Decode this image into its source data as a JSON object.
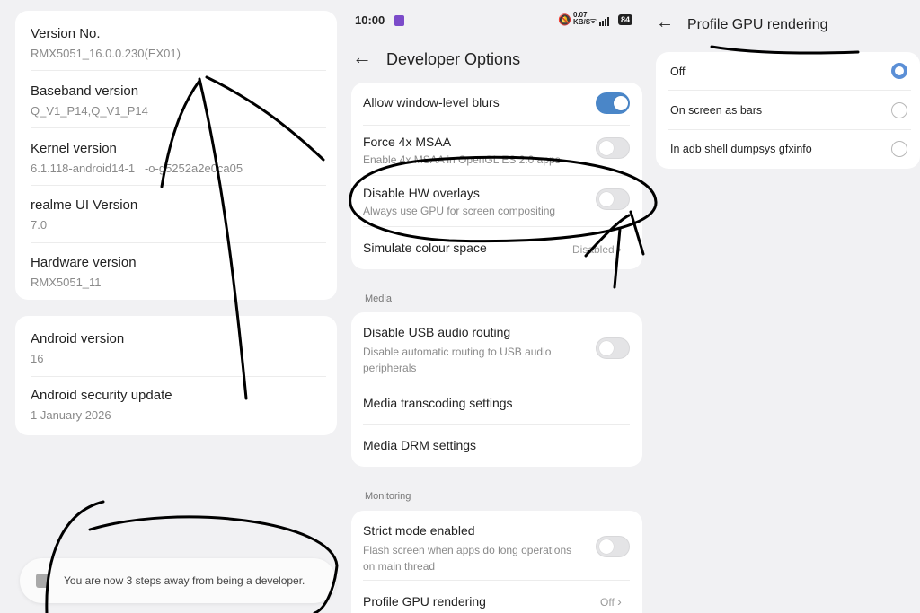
{
  "left": {
    "about_items": [
      {
        "label": "Version No.",
        "value": "RMX5051_16.0.0.230(EX01)"
      },
      {
        "label": "Baseband version",
        "value": "Q_V1_P14,Q_V1_P14"
      },
      {
        "label": "Kernel version",
        "value": "6.1.118-android14-1   -o-g5252a2e0ca05"
      },
      {
        "label": "realme UI Version",
        "value": "7.0"
      },
      {
        "label": "Hardware version",
        "value": "RMX5051_11"
      }
    ],
    "android_items": [
      {
        "label": "Android version",
        "value": "16"
      },
      {
        "label": "Android security update",
        "value": "1 January 2026"
      }
    ],
    "toast": "You are now 3 steps away from being a developer."
  },
  "middle": {
    "status": {
      "time": "10:00",
      "speed": "0.07",
      "speed_unit": "KB/S",
      "battery": "84"
    },
    "title": "Developer Options",
    "top_items": [
      {
        "label": "Allow window-level blurs",
        "sub": "",
        "toggle": true
      },
      {
        "label": "Force 4x MSAA",
        "sub": "Enable 4x MSAA in OpenGL ES 2.0 apps",
        "toggle": false
      },
      {
        "label": "Disable HW overlays",
        "sub": "Always use GPU for screen compositing",
        "toggle": false
      },
      {
        "label": "Simulate colour space",
        "value": "Disabled"
      }
    ],
    "media_header": "Media",
    "media_items": [
      {
        "label": "Disable USB audio routing",
        "sub": "Disable automatic routing to USB audio peripherals",
        "toggle": false
      },
      {
        "label": "Media transcoding settings"
      },
      {
        "label": "Media DRM settings"
      }
    ],
    "monitoring_header": "Monitoring",
    "monitoring_items": [
      {
        "label": "Strict mode enabled",
        "sub": "Flash screen when apps do long operations on main thread",
        "toggle": false
      },
      {
        "label": "Profile GPU rendering",
        "value": "Off"
      }
    ]
  },
  "right": {
    "title": "Profile GPU rendering",
    "options": [
      {
        "label": "Off",
        "selected": true
      },
      {
        "label": "On screen as bars",
        "selected": false
      },
      {
        "label": "In adb shell dumpsys gfxinfo",
        "selected": false
      }
    ]
  },
  "colors": {
    "accent": "#4a86c8",
    "radio_accent": "#5b8fd6",
    "background": "#f1f1f3"
  }
}
